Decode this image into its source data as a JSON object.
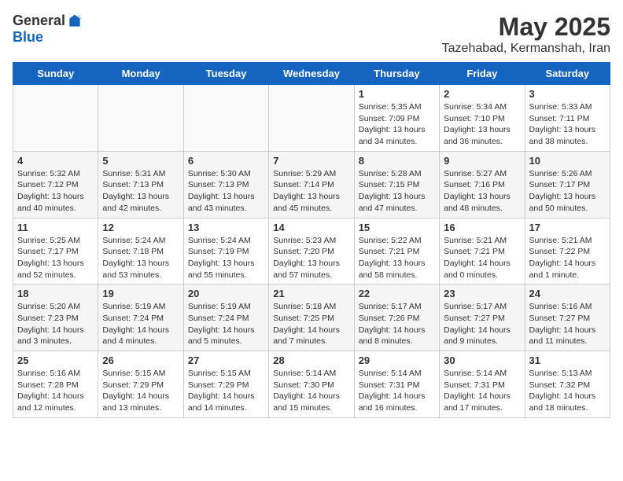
{
  "header": {
    "logo_general": "General",
    "logo_blue": "Blue",
    "month_year": "May 2025",
    "location": "Tazehabad, Kermanshah, Iran"
  },
  "days_of_week": [
    "Sunday",
    "Monday",
    "Tuesday",
    "Wednesday",
    "Thursday",
    "Friday",
    "Saturday"
  ],
  "weeks": [
    [
      {
        "day": "",
        "info": ""
      },
      {
        "day": "",
        "info": ""
      },
      {
        "day": "",
        "info": ""
      },
      {
        "day": "",
        "info": ""
      },
      {
        "day": "1",
        "info": "Sunrise: 5:35 AM\nSunset: 7:09 PM\nDaylight: 13 hours\nand 34 minutes."
      },
      {
        "day": "2",
        "info": "Sunrise: 5:34 AM\nSunset: 7:10 PM\nDaylight: 13 hours\nand 36 minutes."
      },
      {
        "day": "3",
        "info": "Sunrise: 5:33 AM\nSunset: 7:11 PM\nDaylight: 13 hours\nand 38 minutes."
      }
    ],
    [
      {
        "day": "4",
        "info": "Sunrise: 5:32 AM\nSunset: 7:12 PM\nDaylight: 13 hours\nand 40 minutes."
      },
      {
        "day": "5",
        "info": "Sunrise: 5:31 AM\nSunset: 7:13 PM\nDaylight: 13 hours\nand 42 minutes."
      },
      {
        "day": "6",
        "info": "Sunrise: 5:30 AM\nSunset: 7:13 PM\nDaylight: 13 hours\nand 43 minutes."
      },
      {
        "day": "7",
        "info": "Sunrise: 5:29 AM\nSunset: 7:14 PM\nDaylight: 13 hours\nand 45 minutes."
      },
      {
        "day": "8",
        "info": "Sunrise: 5:28 AM\nSunset: 7:15 PM\nDaylight: 13 hours\nand 47 minutes."
      },
      {
        "day": "9",
        "info": "Sunrise: 5:27 AM\nSunset: 7:16 PM\nDaylight: 13 hours\nand 48 minutes."
      },
      {
        "day": "10",
        "info": "Sunrise: 5:26 AM\nSunset: 7:17 PM\nDaylight: 13 hours\nand 50 minutes."
      }
    ],
    [
      {
        "day": "11",
        "info": "Sunrise: 5:25 AM\nSunset: 7:17 PM\nDaylight: 13 hours\nand 52 minutes."
      },
      {
        "day": "12",
        "info": "Sunrise: 5:24 AM\nSunset: 7:18 PM\nDaylight: 13 hours\nand 53 minutes."
      },
      {
        "day": "13",
        "info": "Sunrise: 5:24 AM\nSunset: 7:19 PM\nDaylight: 13 hours\nand 55 minutes."
      },
      {
        "day": "14",
        "info": "Sunrise: 5:23 AM\nSunset: 7:20 PM\nDaylight: 13 hours\nand 57 minutes."
      },
      {
        "day": "15",
        "info": "Sunrise: 5:22 AM\nSunset: 7:21 PM\nDaylight: 13 hours\nand 58 minutes."
      },
      {
        "day": "16",
        "info": "Sunrise: 5:21 AM\nSunset: 7:21 PM\nDaylight: 14 hours\nand 0 minutes."
      },
      {
        "day": "17",
        "info": "Sunrise: 5:21 AM\nSunset: 7:22 PM\nDaylight: 14 hours\nand 1 minute."
      }
    ],
    [
      {
        "day": "18",
        "info": "Sunrise: 5:20 AM\nSunset: 7:23 PM\nDaylight: 14 hours\nand 3 minutes."
      },
      {
        "day": "19",
        "info": "Sunrise: 5:19 AM\nSunset: 7:24 PM\nDaylight: 14 hours\nand 4 minutes."
      },
      {
        "day": "20",
        "info": "Sunrise: 5:19 AM\nSunset: 7:24 PM\nDaylight: 14 hours\nand 5 minutes."
      },
      {
        "day": "21",
        "info": "Sunrise: 5:18 AM\nSunset: 7:25 PM\nDaylight: 14 hours\nand 7 minutes."
      },
      {
        "day": "22",
        "info": "Sunrise: 5:17 AM\nSunset: 7:26 PM\nDaylight: 14 hours\nand 8 minutes."
      },
      {
        "day": "23",
        "info": "Sunrise: 5:17 AM\nSunset: 7:27 PM\nDaylight: 14 hours\nand 9 minutes."
      },
      {
        "day": "24",
        "info": "Sunrise: 5:16 AM\nSunset: 7:27 PM\nDaylight: 14 hours\nand 11 minutes."
      }
    ],
    [
      {
        "day": "25",
        "info": "Sunrise: 5:16 AM\nSunset: 7:28 PM\nDaylight: 14 hours\nand 12 minutes."
      },
      {
        "day": "26",
        "info": "Sunrise: 5:15 AM\nSunset: 7:29 PM\nDaylight: 14 hours\nand 13 minutes."
      },
      {
        "day": "27",
        "info": "Sunrise: 5:15 AM\nSunset: 7:29 PM\nDaylight: 14 hours\nand 14 minutes."
      },
      {
        "day": "28",
        "info": "Sunrise: 5:14 AM\nSunset: 7:30 PM\nDaylight: 14 hours\nand 15 minutes."
      },
      {
        "day": "29",
        "info": "Sunrise: 5:14 AM\nSunset: 7:31 PM\nDaylight: 14 hours\nand 16 minutes."
      },
      {
        "day": "30",
        "info": "Sunrise: 5:14 AM\nSunset: 7:31 PM\nDaylight: 14 hours\nand 17 minutes."
      },
      {
        "day": "31",
        "info": "Sunrise: 5:13 AM\nSunset: 7:32 PM\nDaylight: 14 hours\nand 18 minutes."
      }
    ]
  ]
}
